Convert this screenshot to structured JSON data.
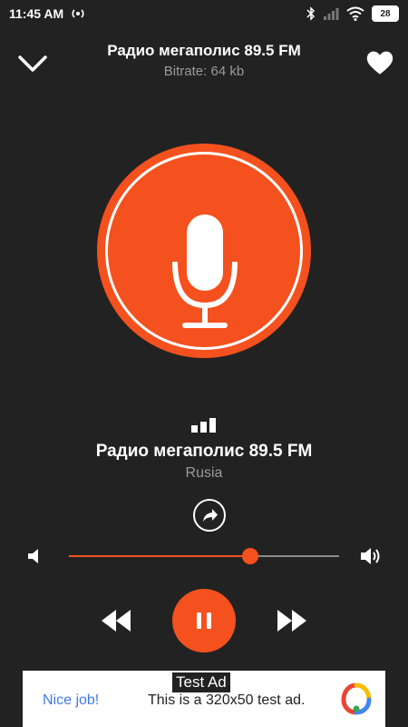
{
  "status_bar": {
    "time": "11:45 AM",
    "battery": "28",
    "icons": [
      "hotspot-icon",
      "bluetooth-icon",
      "signal-icon",
      "wifi-icon",
      "battery-icon"
    ]
  },
  "header": {
    "title": "Радио мегаполис 89.5 FM",
    "subtitle": "Bitrate: 64 kb",
    "left_icon": "chevron-down-icon",
    "right_icon": "heart-icon"
  },
  "artwork": {
    "icon": "microphone-icon",
    "color": "#f4511e"
  },
  "station": {
    "name": "Радио мегаполис 89.5 FM",
    "country": "Rusia"
  },
  "share": {
    "icon": "share-icon"
  },
  "volume": {
    "level": 0.67,
    "accent": "#f4511e"
  },
  "controls": {
    "prev_icon": "rewind-icon",
    "play_state": "playing",
    "play_icon": "pause-icon",
    "next_icon": "fast-forward-icon"
  },
  "ad": {
    "label": "Test Ad",
    "nice": "Nice job!",
    "text": "This is a 320x50 test ad."
  },
  "colors": {
    "background": "#222222",
    "accent": "#f4511e",
    "muted": "#9a9a9a"
  }
}
